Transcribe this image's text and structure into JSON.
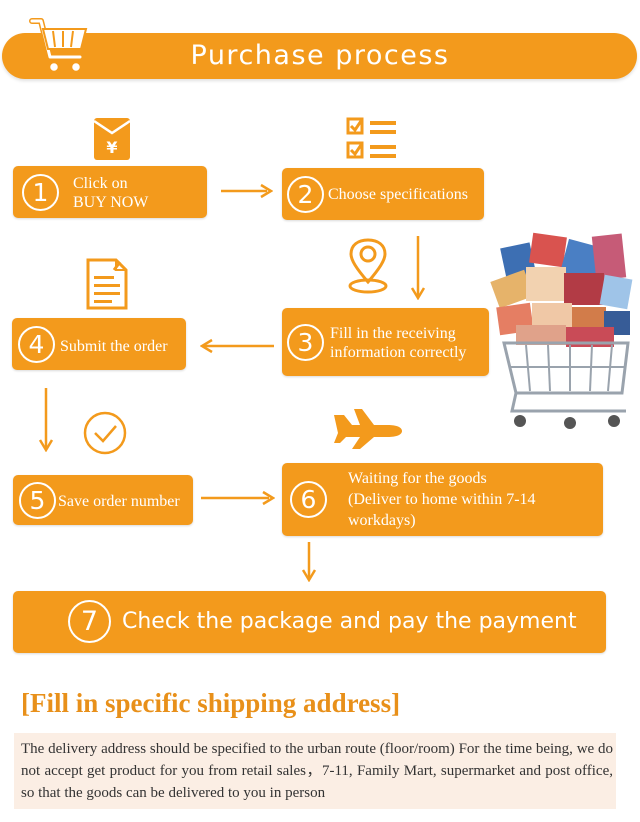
{
  "banner": {
    "title": "Purchase process",
    "icon": "shopping-cart-icon"
  },
  "steps": [
    {
      "num": "1",
      "label_line1": "Click on",
      "label_line2": "BUY NOW"
    },
    {
      "num": "2",
      "label": "Choose specifications"
    },
    {
      "num": "3",
      "label_line1": "Fill in the receiving",
      "label_line2": "information correctly"
    },
    {
      "num": "4",
      "label": "Submit the order"
    },
    {
      "num": "5",
      "label": "Save order number"
    },
    {
      "num": "6",
      "label_line1": "Waiting for the goods",
      "label_line2": "(Deliver to home within 7-14",
      "label_line3": "workdays)"
    },
    {
      "num": "7",
      "label": "Check the package and pay the payment"
    }
  ],
  "icons": [
    "red-envelope-yuan-icon",
    "checklist-icon",
    "location-pin-icon",
    "document-icon",
    "checkmark-circle-icon",
    "airplane-icon",
    "shopping-cart-full-icon"
  ],
  "colors": {
    "accent": "#f39a1c",
    "title": "#e8901a",
    "note_bg": "#fbeee4"
  },
  "shipping": {
    "title": "[Fill in specific shipping address]",
    "text": "The delivery address should be specified to the urban route (floor/room) For the time being, we do not accept get product for you from retail sales，7-11, Family Mart, supermarket and post office, so that the goods can be delivered to you in person"
  }
}
